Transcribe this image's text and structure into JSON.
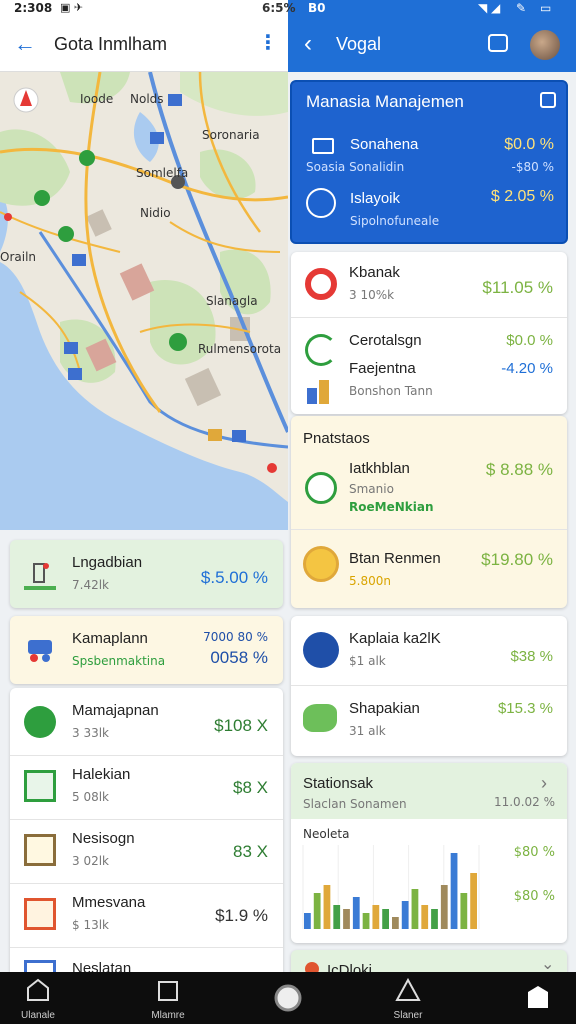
{
  "status_bar": {
    "left_time": "2:308",
    "right_time": "6:5%",
    "right_code": "B0",
    "right_icons": [
      "wifi-icon",
      "signal-icon",
      "battery-icon"
    ]
  },
  "left_header": {
    "back_icon": "arrow-back-icon",
    "title": "Gota Inmlham",
    "menu_icon": "more-vertical-icon"
  },
  "map": {
    "labels": [
      "Ioode",
      "Nolds",
      "Soronaria",
      "Somlelfa",
      "Nidio",
      "Orailn",
      "Slanagla",
      "Rulmensorota"
    ],
    "marker_colors": [
      "#e53935",
      "#2e9e3e"
    ]
  },
  "right_header": {
    "back_icon": "chevron-left-icon",
    "title": "Vogal",
    "chat_icon": "chat-icon",
    "avatar_icon": "avatar-icon"
  },
  "highlight_card": {
    "title": "Manasia Manajemen",
    "edit_icon": "edit-icon",
    "rows": [
      {
        "icon": "card-icon",
        "name": "Sonahena",
        "sub": "Soasia  Sonalidin",
        "value": "$0.0 %",
        "sub_value": "-$80 %"
      },
      {
        "icon": "globe-icon",
        "name": "Islayoik",
        "sub": "Sipolnofuneale",
        "value": "$ 2.05 %"
      }
    ]
  },
  "left_cards": [
    {
      "rows": [
        {
          "icon": "pump-icon",
          "name": "Lngadbian",
          "sub": "7.42lk",
          "value": "$.5.00 %",
          "value_color": "#1f6fd6"
        }
      ],
      "bg": "#e3f2df"
    },
    {
      "rows": [
        {
          "icon": "bus-icon",
          "name": "Kamaplann",
          "sub": "Spsbenmaktina",
          "value_top": "7000 80 %",
          "value": "0058 %",
          "value_color": "#1f4fa8",
          "sub_color": "#2e9e3e"
        }
      ],
      "bg": "#fdf7e3"
    },
    {
      "rows": [
        {
          "icon": "leaf-icon",
          "name": "Mamajapnan",
          "sub": "3 33lk",
          "value": "$108 X",
          "value_color": "#2e7d32"
        },
        {
          "icon": "doc-icon",
          "name": "Halekian",
          "sub": "5 08lk",
          "value": "$8 X",
          "value_color": "#2e7d32"
        },
        {
          "icon": "note-icon",
          "name": "Nesisogn",
          "sub": "3 02lk",
          "value": "83 X",
          "value_color": "#2e7d32"
        },
        {
          "icon": "list-icon",
          "name": "Mmesvana",
          "sub": "$ 13lk",
          "value": "$1.9 %",
          "value_color": "#333"
        },
        {
          "icon": "calendar-icon",
          "name": "Neslatan",
          "sub": "",
          "value": ""
        }
      ]
    }
  ],
  "right_cards": [
    {
      "rows": [
        {
          "icon": "target-icon",
          "name": "Kbanak",
          "sub": "3 10%k",
          "value": "$11.05 %",
          "value_color": "#7cb342"
        },
        {
          "icon": "pen-icon",
          "name": "Cerotalsgn",
          "sub": "",
          "value": "$0.0 %",
          "value_color": "#7cb342"
        },
        {
          "icon": "chart-icon",
          "name": "Faejentna",
          "sub": "Bonshon Tann",
          "value": "-4.20 %",
          "value_color": "#1f6fd6"
        }
      ]
    },
    {
      "section_title": "Pnatstaos",
      "rows": [
        {
          "icon": "plant-icon",
          "name": "Iatkhblan",
          "sub": "Smanio",
          "sub2": "RoeMeNkian",
          "value": "$ 8.88 %",
          "value_color": "#7cb342"
        },
        {
          "icon": "badge-icon",
          "name": "Btan Renmen",
          "sub": "5.800n",
          "value": "$19.80 %",
          "value_color": "#7cb342",
          "sub_color": "#d9a400"
        }
      ],
      "bg": "#fdf7e3"
    },
    {
      "rows": [
        {
          "icon": "planet-icon",
          "name": "Kaplaia ka2lK",
          "sub": "$1 alk",
          "value": "$38 %",
          "value_color": "#7cb342"
        },
        {
          "icon": "map-icon",
          "name": "Shapakian",
          "sub": "31 alk",
          "value": "$15.3 %",
          "value_color": "#7cb342"
        }
      ]
    }
  ],
  "chart_card": {
    "title": "Stationsak",
    "subtitle": "Slaclan Sonamen",
    "header_value": "11.0.02 %",
    "label": "Neoleta",
    "value_top": "$80 %",
    "value_bottom": "$80 %",
    "chevron_icon": "chevron-right-icon"
  },
  "chart_data": {
    "type": "bar",
    "title": "",
    "categories": [
      "1",
      "2",
      "3",
      "4",
      "5",
      "6",
      "7",
      "8",
      "9",
      "10",
      "11",
      "12",
      "13",
      "14",
      "15",
      "16",
      "17",
      "18"
    ],
    "series": [
      {
        "values": [
          20,
          45,
          55,
          30,
          25,
          40,
          20,
          30,
          25,
          15,
          35,
          50,
          30,
          25,
          55,
          95,
          45,
          70
        ]
      }
    ],
    "colors": [
      "#3a7bd5",
      "#7cb342",
      "#e0a83a",
      "#43a047",
      "#a08a5c"
    ]
  },
  "partial_card": {
    "name": "IcDloki"
  },
  "bottom_nav": {
    "items": [
      {
        "icon": "home-icon",
        "label": "Ulanale"
      },
      {
        "icon": "book-icon",
        "label": "Mlamre"
      },
      {
        "icon": "circle-button-icon",
        "label": ""
      },
      {
        "icon": "warning-icon",
        "label": "Slaner"
      },
      {
        "icon": "profile-icon",
        "label": ""
      }
    ]
  }
}
